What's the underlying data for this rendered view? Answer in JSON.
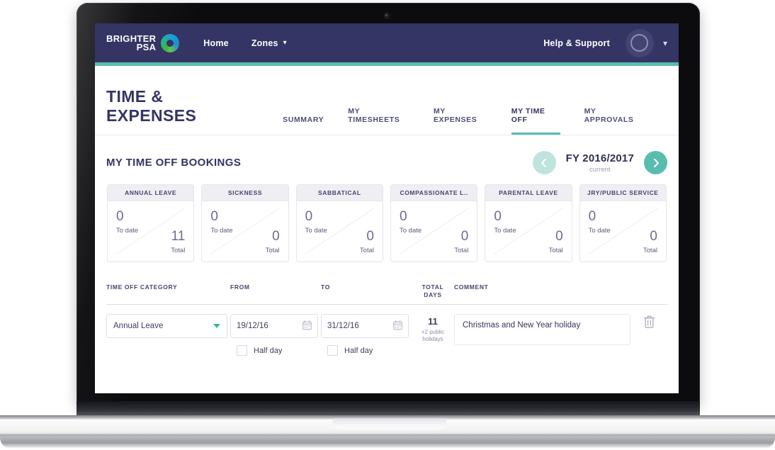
{
  "brand": {
    "logo_line1": "BRIGHTER",
    "logo_line2": "PSA",
    "navy": "#343564",
    "teal": "#5bbcae"
  },
  "navbar": {
    "home_label": "Home",
    "zones_label": "Zones",
    "zones_caret": "chevron-down",
    "help_label": "Help & Support",
    "account_caret": "chevron-down"
  },
  "header": {
    "page_title": "TIME & EXPENSES",
    "tabs": [
      {
        "label": "SUMMARY",
        "active": false
      },
      {
        "label": "MY TIMESHEETS",
        "active": false
      },
      {
        "label": "MY EXPENSES",
        "active": false
      },
      {
        "label": "MY TIME OFF",
        "active": true
      },
      {
        "label": "MY APPROVALS",
        "active": false
      }
    ]
  },
  "section": {
    "title": "MY TIME OFF BOOKINGS",
    "fiscal_year": "FY 2016/2017",
    "fiscal_year_note": "current",
    "prev_label": "Previous fiscal year",
    "next_label": "Next fiscal year"
  },
  "cards": [
    {
      "title": "ANNUAL LEAVE",
      "to_date": "0",
      "to_date_label": "To date",
      "total": "11",
      "total_label": "Total"
    },
    {
      "title": "SICKNESS",
      "to_date": "0",
      "to_date_label": "To date",
      "total": "0",
      "total_label": "Total"
    },
    {
      "title": "SABBATICAL",
      "to_date": "0",
      "to_date_label": "To date",
      "total": "0",
      "total_label": "Total"
    },
    {
      "title": "COMPASSIONATE L..",
      "to_date": "0",
      "to_date_label": "To date",
      "total": "0",
      "total_label": "Total"
    },
    {
      "title": "PARENTAL LEAVE",
      "to_date": "0",
      "to_date_label": "To date",
      "total": "0",
      "total_label": "Total"
    },
    {
      "title": "JRY/PUBLIC SERVICE",
      "to_date": "0",
      "to_date_label": "To date",
      "total": "0",
      "total_label": "Total"
    }
  ],
  "table": {
    "headers": {
      "category": "TIME OFF CATEGORY",
      "from": "FROM",
      "to": "TO",
      "total_days_l1": "TOTAL",
      "total_days_l2": "DAYS",
      "comment": "COMMENT"
    },
    "row": {
      "category_value": "Annual Leave",
      "from_value": "19/12/16",
      "from_half_day_label": "Half day",
      "from_half_day_checked": false,
      "to_value": "31/12/16",
      "to_half_day_label": "Half day",
      "to_half_day_checked": false,
      "total_days": "11",
      "total_days_note_l1": "+2 public",
      "total_days_note_l2": "holidays",
      "comment_value": "Christmas and New Year holiday",
      "delete_icon": "trash-icon"
    }
  }
}
